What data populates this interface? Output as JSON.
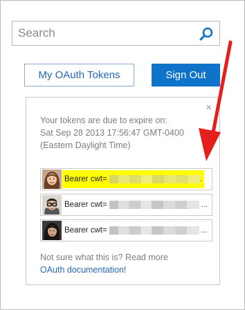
{
  "search": {
    "placeholder": "Search"
  },
  "buttons": {
    "my_tokens": "My OAuth Tokens",
    "sign_out": "Sign Out"
  },
  "panel": {
    "close_glyph": "×",
    "expire_lines": [
      "Your tokens are due to expire on:",
      "Sat Sep 28 2013 17:56:47 GMT-0400",
      "(Eastern Daylight Time)"
    ],
    "tokens": [
      {
        "label": "Bearer cwt=",
        "highlighted": true,
        "ellipsis": "."
      },
      {
        "label": "Bearer cwt=",
        "highlighted": false,
        "ellipsis": "..."
      },
      {
        "label": "Bearer cwt=",
        "highlighted": false,
        "ellipsis": "..."
      }
    ],
    "footer_text": "Not sure what this is? Read more",
    "footer_link": "OAuth documentation!"
  },
  "colors": {
    "accent_blue": "#0f73c9",
    "link_blue": "#2668b6",
    "highlight_yellow": "#fffd00",
    "annotation_red": "#e3201b"
  }
}
